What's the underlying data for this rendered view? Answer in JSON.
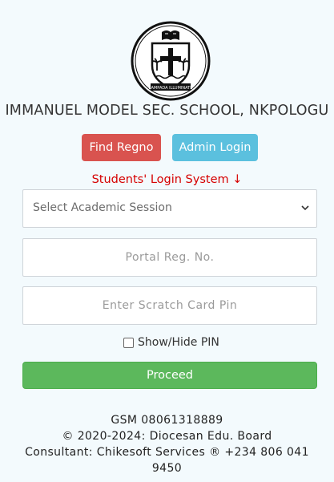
{
  "school": {
    "name": "IMMANUEL MODEL SEC. SCHOOL, NKPOLOGU",
    "logo_motto": "LAMPADA ILLUMINATE"
  },
  "buttons": {
    "find_regno": "Find Regno",
    "admin_login": "Admin Login",
    "proceed": "Proceed"
  },
  "login": {
    "title": "Students' Login System ↓",
    "session_select": {
      "selected": "Select Academic Session"
    },
    "reg_no": {
      "placeholder": "Portal Reg. No."
    },
    "pin": {
      "placeholder": "Enter Scratch Card Pin"
    },
    "show_pin_label": "Show/Hide PIN"
  },
  "footer": {
    "gsm": "GSM 08061318889",
    "copyright": "© 2020-2024: Diocesan Edu. Board",
    "consultant": "Consultant: Chikesoft Services ® +234 806 041 9450"
  },
  "colors": {
    "danger": "#d9534f",
    "info": "#5bc0de",
    "success": "#5cb85c",
    "alert_text": "#d60000"
  },
  "icons": [
    "school-crest-icon",
    "chevron-down-icon",
    "checkbox-icon"
  ]
}
